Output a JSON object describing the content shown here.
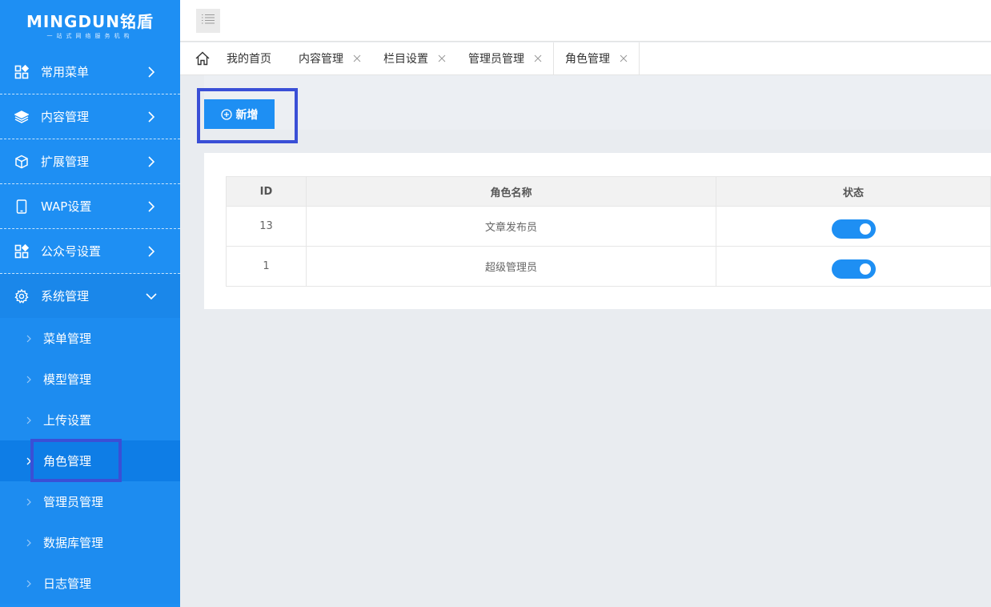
{
  "logo": {
    "main": "MINGDUN铭盾",
    "sub": "一站式网络服务机构"
  },
  "sidebar": {
    "items": [
      {
        "label": "常用菜单",
        "icon": "grid-icon"
      },
      {
        "label": "内容管理",
        "icon": "layers-icon"
      },
      {
        "label": "扩展管理",
        "icon": "box-icon"
      },
      {
        "label": "WAP设置",
        "icon": "phone-icon"
      },
      {
        "label": "公众号设置",
        "icon": "grid-icon"
      },
      {
        "label": "系统管理",
        "icon": "gear-icon",
        "open": true
      }
    ],
    "submenu": [
      {
        "label": "菜单管理"
      },
      {
        "label": "模型管理"
      },
      {
        "label": "上传设置"
      },
      {
        "label": "角色管理",
        "active": true
      },
      {
        "label": "管理员管理"
      },
      {
        "label": "数据库管理"
      },
      {
        "label": "日志管理"
      }
    ]
  },
  "tabs": [
    {
      "label": "我的首页",
      "closable": false
    },
    {
      "label": "内容管理",
      "closable": true
    },
    {
      "label": "栏目设置",
      "closable": true
    },
    {
      "label": "管理员管理",
      "closable": true
    },
    {
      "label": "角色管理",
      "closable": true,
      "active": true
    }
  ],
  "toolbar": {
    "add_label": "新增"
  },
  "table": {
    "headers": [
      "ID",
      "角色名称",
      "状态"
    ],
    "rows": [
      {
        "id": "13",
        "name": "文章发布员",
        "status": "on"
      },
      {
        "id": "1",
        "name": "超级管理员",
        "status": "on"
      }
    ]
  },
  "colors": {
    "primary": "#1e8ff3",
    "highlight": "#3a4fd6",
    "background": "#e9ecf0"
  }
}
